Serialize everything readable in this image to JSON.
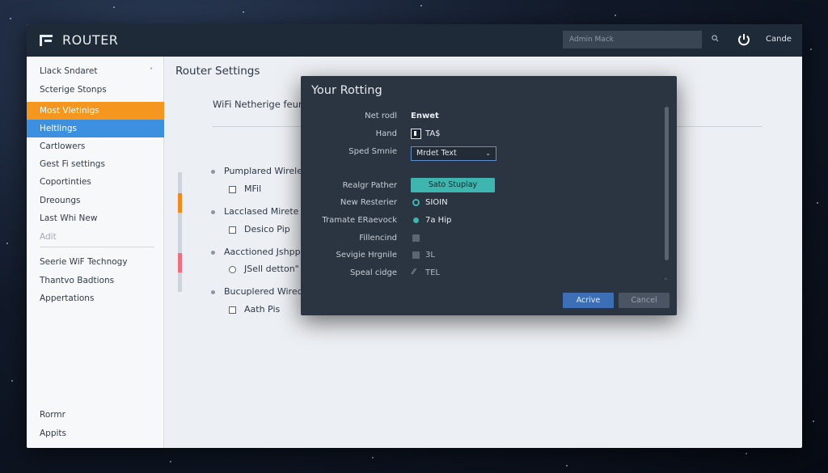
{
  "app": {
    "title": "ROUTER",
    "search_placeholder": "Admin Mack",
    "user": "Cande"
  },
  "sidebar": {
    "items": [
      {
        "label": "Llack Sndaret",
        "state": "normal"
      },
      {
        "label": "Scterige Stonps",
        "state": "normal"
      },
      {
        "label": "Most Vletinigs",
        "state": "highlight-orange"
      },
      {
        "label": "Heltlings",
        "state": "selected"
      },
      {
        "label": "Cartlowers",
        "state": "normal"
      },
      {
        "label": "Gest Fi settings",
        "state": "normal"
      },
      {
        "label": "Coportinties",
        "state": "normal"
      },
      {
        "label": "Dreoungs",
        "state": "normal"
      },
      {
        "label": "Last Whi New",
        "state": "normal"
      },
      {
        "label": "Adit",
        "state": "disabled"
      },
      {
        "label": "Seerie WiF Technogy",
        "state": "normal"
      },
      {
        "label": "Thantvo Badtions",
        "state": "normal"
      },
      {
        "label": "Appertations",
        "state": "normal"
      }
    ],
    "bottom_items": [
      "Rormr",
      "Appits"
    ],
    "caret": "˄"
  },
  "main": {
    "title": "Router Settings",
    "section_heading": "WiFi Netherige feur",
    "options": [
      {
        "label": "Pumplared Wirele",
        "sub": "MFil",
        "control": "checkbox"
      },
      {
        "label": "Lacclased Mirete",
        "sub": "Desico Pip",
        "control": "checkbox"
      },
      {
        "label": "Aacctioned Jshpp",
        "sub": "JSell detton\"",
        "control": "radio"
      },
      {
        "label": "Bucuplered Wirede",
        "sub": "Aath Pis",
        "control": "checkbox"
      }
    ]
  },
  "dialog": {
    "title": "Your Rotting",
    "rows": [
      {
        "label": "Net rodl",
        "value": "Enwet"
      },
      {
        "label": "Hand",
        "value": "TA$"
      },
      {
        "label": "Sped Smnie",
        "value": "Mrdet Text"
      },
      {
        "label": "Realgr Pather",
        "value": "Sato Stuplay"
      },
      {
        "label": "New Resterier",
        "value": "SIOIN"
      },
      {
        "label": "Tramate ERaevock",
        "value": "7a Hip"
      },
      {
        "label": "Fillencind",
        "value": ""
      },
      {
        "label": "Sevigie Hrgnile",
        "value": "3L"
      },
      {
        "label": "Speal cidge",
        "value": "TEL"
      }
    ],
    "primary_button": "Acrive",
    "secondary_button": "Cancel"
  },
  "colors": {
    "accent_orange": "#f5961e",
    "accent_blue": "#3d8fe0",
    "teal": "#3fb5b0",
    "titlebar": "#1f2a38",
    "dialog_bg": "#2b3542"
  }
}
